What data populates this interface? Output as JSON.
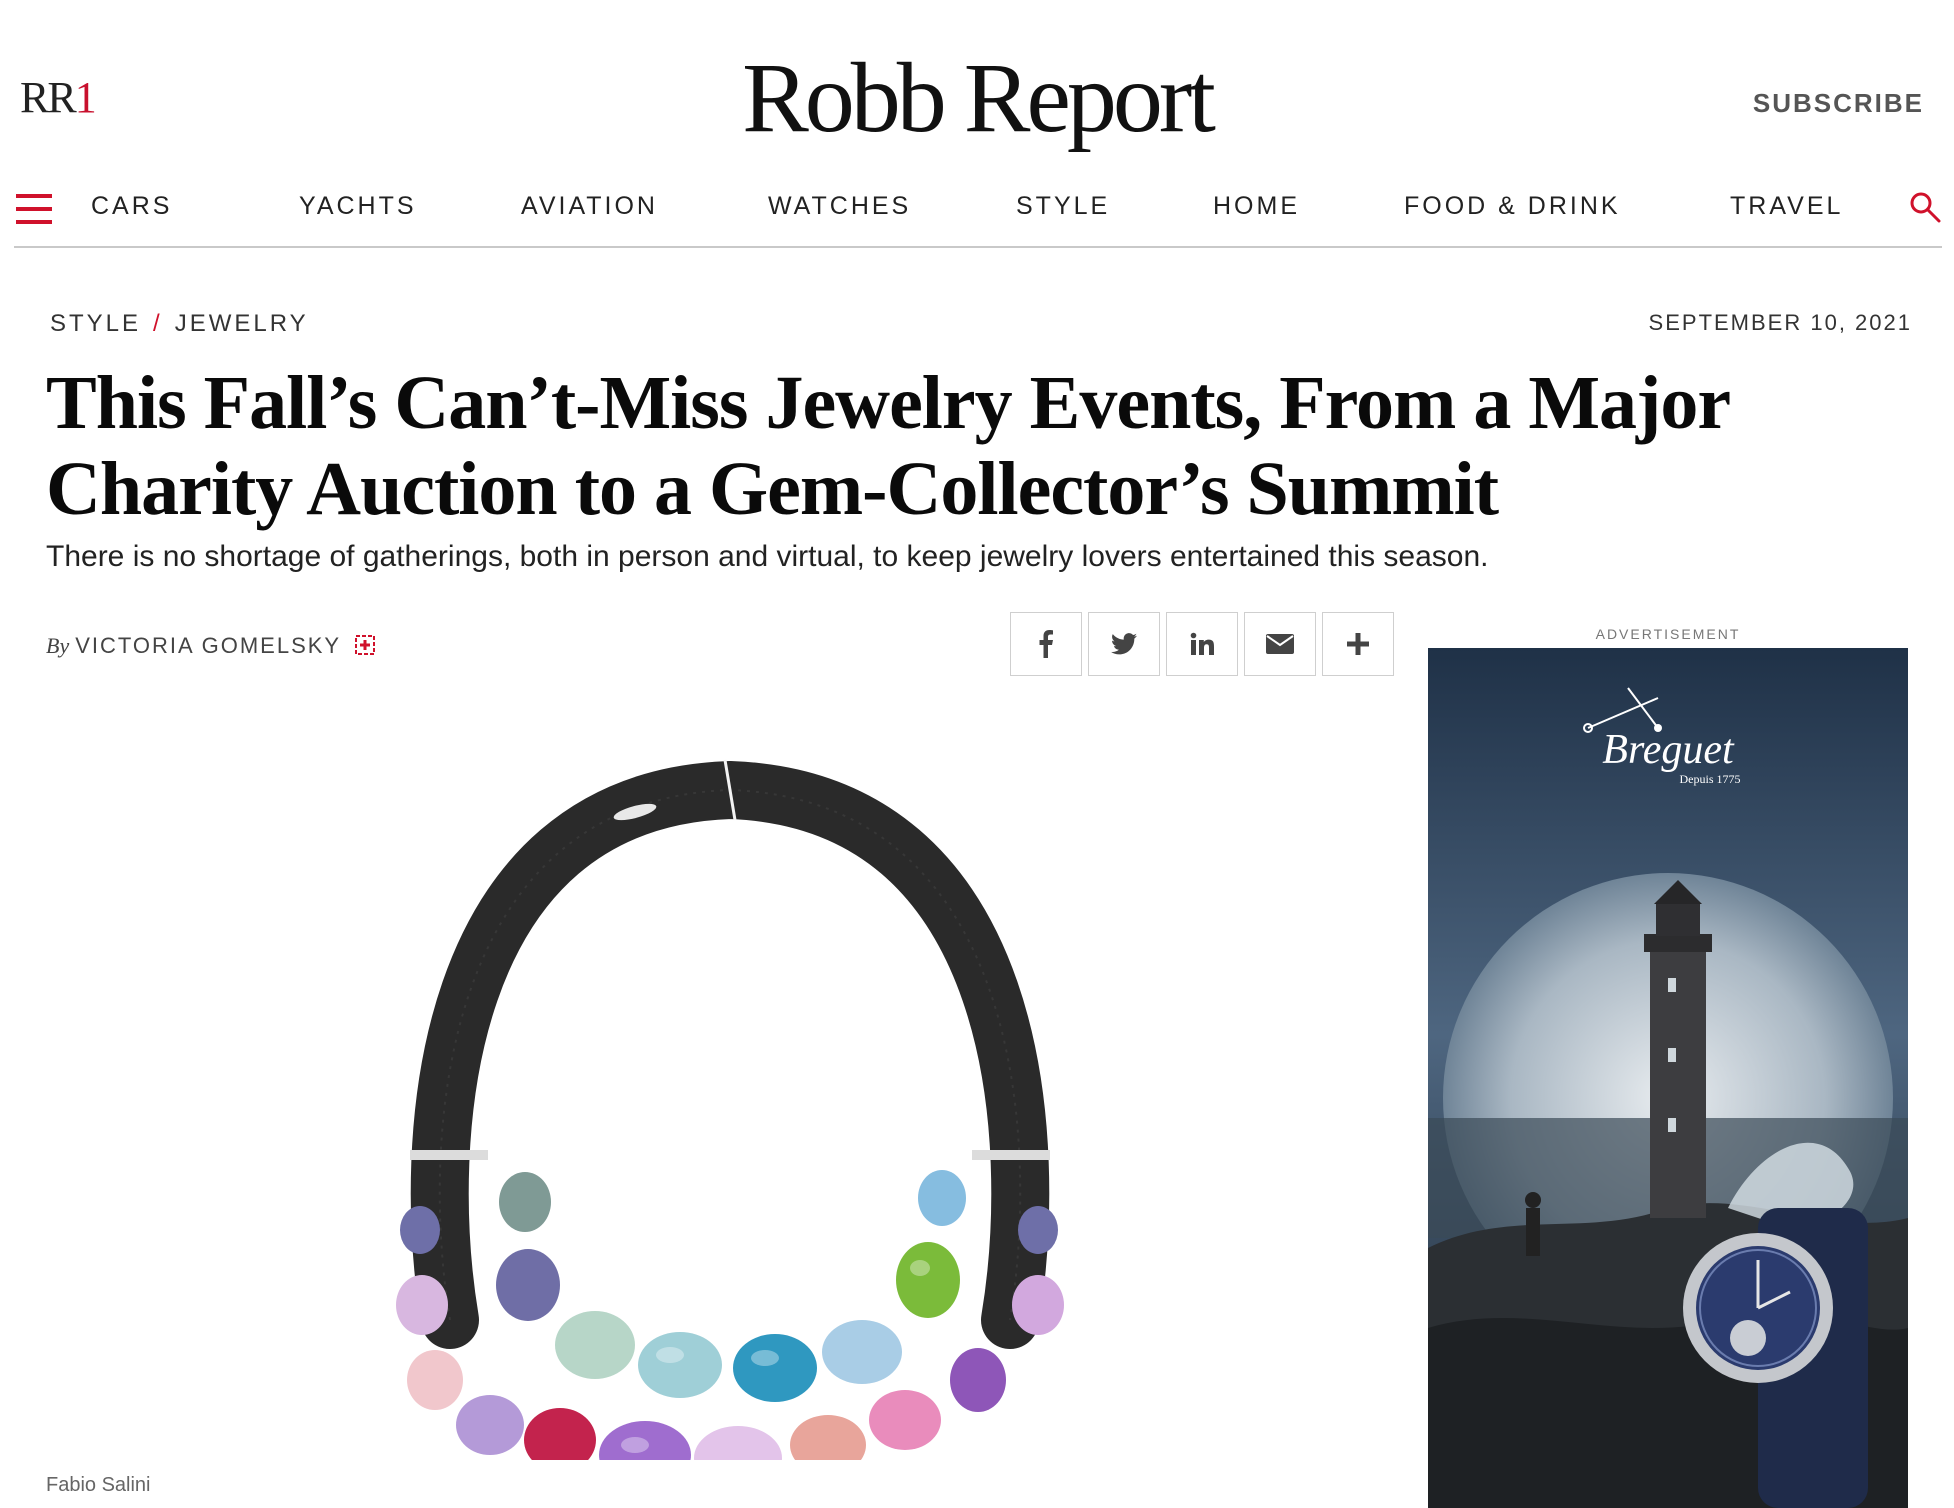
{
  "header": {
    "logo_small": {
      "letters": "RR",
      "digit": "1"
    },
    "masthead": "Robb Report",
    "subscribe_label": "SUBSCRIBE"
  },
  "nav": {
    "items": [
      "CARS",
      "YACHTS",
      "AVIATION",
      "WATCHES",
      "STYLE",
      "HOME",
      "FOOD & DRINK",
      "TRAVEL"
    ],
    "menu_icon": "hamburger-icon",
    "search_icon": "search-icon"
  },
  "article": {
    "breadcrumb": {
      "section": "STYLE",
      "separator": "/",
      "subsection": "JEWELRY"
    },
    "date": "SEPTEMBER 10, 2021",
    "headline": "This Fall’s Can’t-Miss Jewelry Events, From a Major Charity Auction to a Gem-Collector’s Summit",
    "dek": "There is no shortage of gatherings, both in person and virtual, to keep jewelry lovers entertained this season.",
    "byline": {
      "prefix": "By",
      "author": "VICTORIA GOMELSKY"
    },
    "share": [
      "facebook-icon",
      "twitter-icon",
      "linkedin-icon",
      "email-icon",
      "plus-icon"
    ],
    "image_caption": "Fabio Salini"
  },
  "ad": {
    "label": "ADVERTISEMENT",
    "brand": "Breguet",
    "tagline": "Depuis 1775"
  },
  "colors": {
    "accent": "#d0112b",
    "text": "#111111",
    "rule": "#c9c9c9"
  }
}
